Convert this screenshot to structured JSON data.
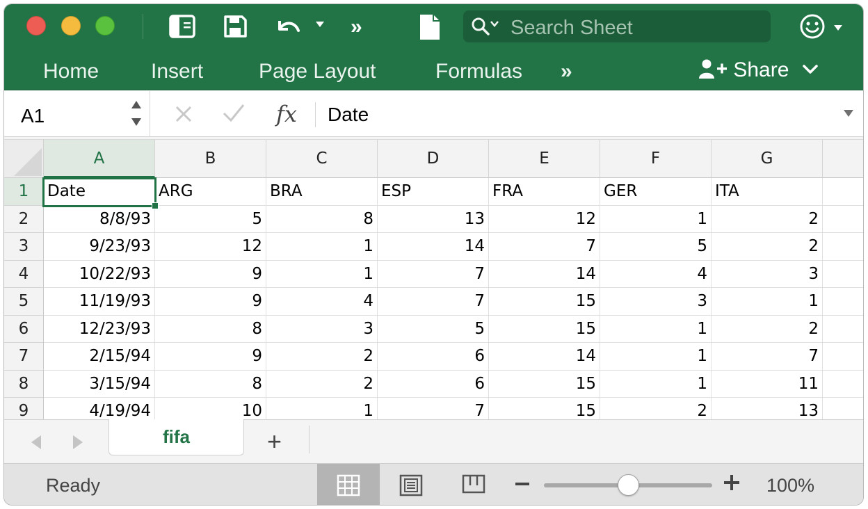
{
  "toolbar": {
    "search_placeholder": "Search Sheet",
    "more_glyph": "»"
  },
  "ribbon": {
    "tabs": [
      "Home",
      "Insert",
      "Page Layout",
      "Formulas"
    ],
    "more_glyph": "»",
    "share_label": "Share"
  },
  "formula_bar": {
    "name_box": "A1",
    "fx_label": "fx",
    "value": "Date"
  },
  "sheet": {
    "columns": [
      "A",
      "B",
      "C",
      "D",
      "E",
      "F",
      "G"
    ],
    "rows": [
      {
        "num": "1",
        "cells": [
          "Date",
          "ARG",
          "BRA",
          "ESP",
          "FRA",
          "GER",
          "ITA"
        ]
      },
      {
        "num": "2",
        "cells": [
          "8/8/93",
          "5",
          "8",
          "13",
          "12",
          "1",
          "2"
        ]
      },
      {
        "num": "3",
        "cells": [
          "9/23/93",
          "12",
          "1",
          "14",
          "7",
          "5",
          "2"
        ]
      },
      {
        "num": "4",
        "cells": [
          "10/22/93",
          "9",
          "1",
          "7",
          "14",
          "4",
          "3"
        ]
      },
      {
        "num": "5",
        "cells": [
          "11/19/93",
          "9",
          "4",
          "7",
          "15",
          "3",
          "1"
        ]
      },
      {
        "num": "6",
        "cells": [
          "12/23/93",
          "8",
          "3",
          "5",
          "15",
          "1",
          "2"
        ]
      },
      {
        "num": "7",
        "cells": [
          "2/15/94",
          "9",
          "2",
          "6",
          "14",
          "1",
          "7"
        ]
      },
      {
        "num": "8",
        "cells": [
          "3/15/94",
          "8",
          "2",
          "6",
          "15",
          "1",
          "11"
        ]
      },
      {
        "num": "9",
        "cells": [
          "4/19/94",
          "10",
          "1",
          "7",
          "15",
          "2",
          "13"
        ]
      }
    ],
    "active_cell": "A1",
    "active_col": "A",
    "active_row": "1"
  },
  "tabs": {
    "sheets": [
      "fifa"
    ],
    "active_sheet": "fifa",
    "add_glyph": "+"
  },
  "status": {
    "text": "Ready",
    "zoom": "100%",
    "zoom_level_percent": 100
  },
  "colors": {
    "accent_green": "#227447",
    "selection_green": "#217346"
  }
}
